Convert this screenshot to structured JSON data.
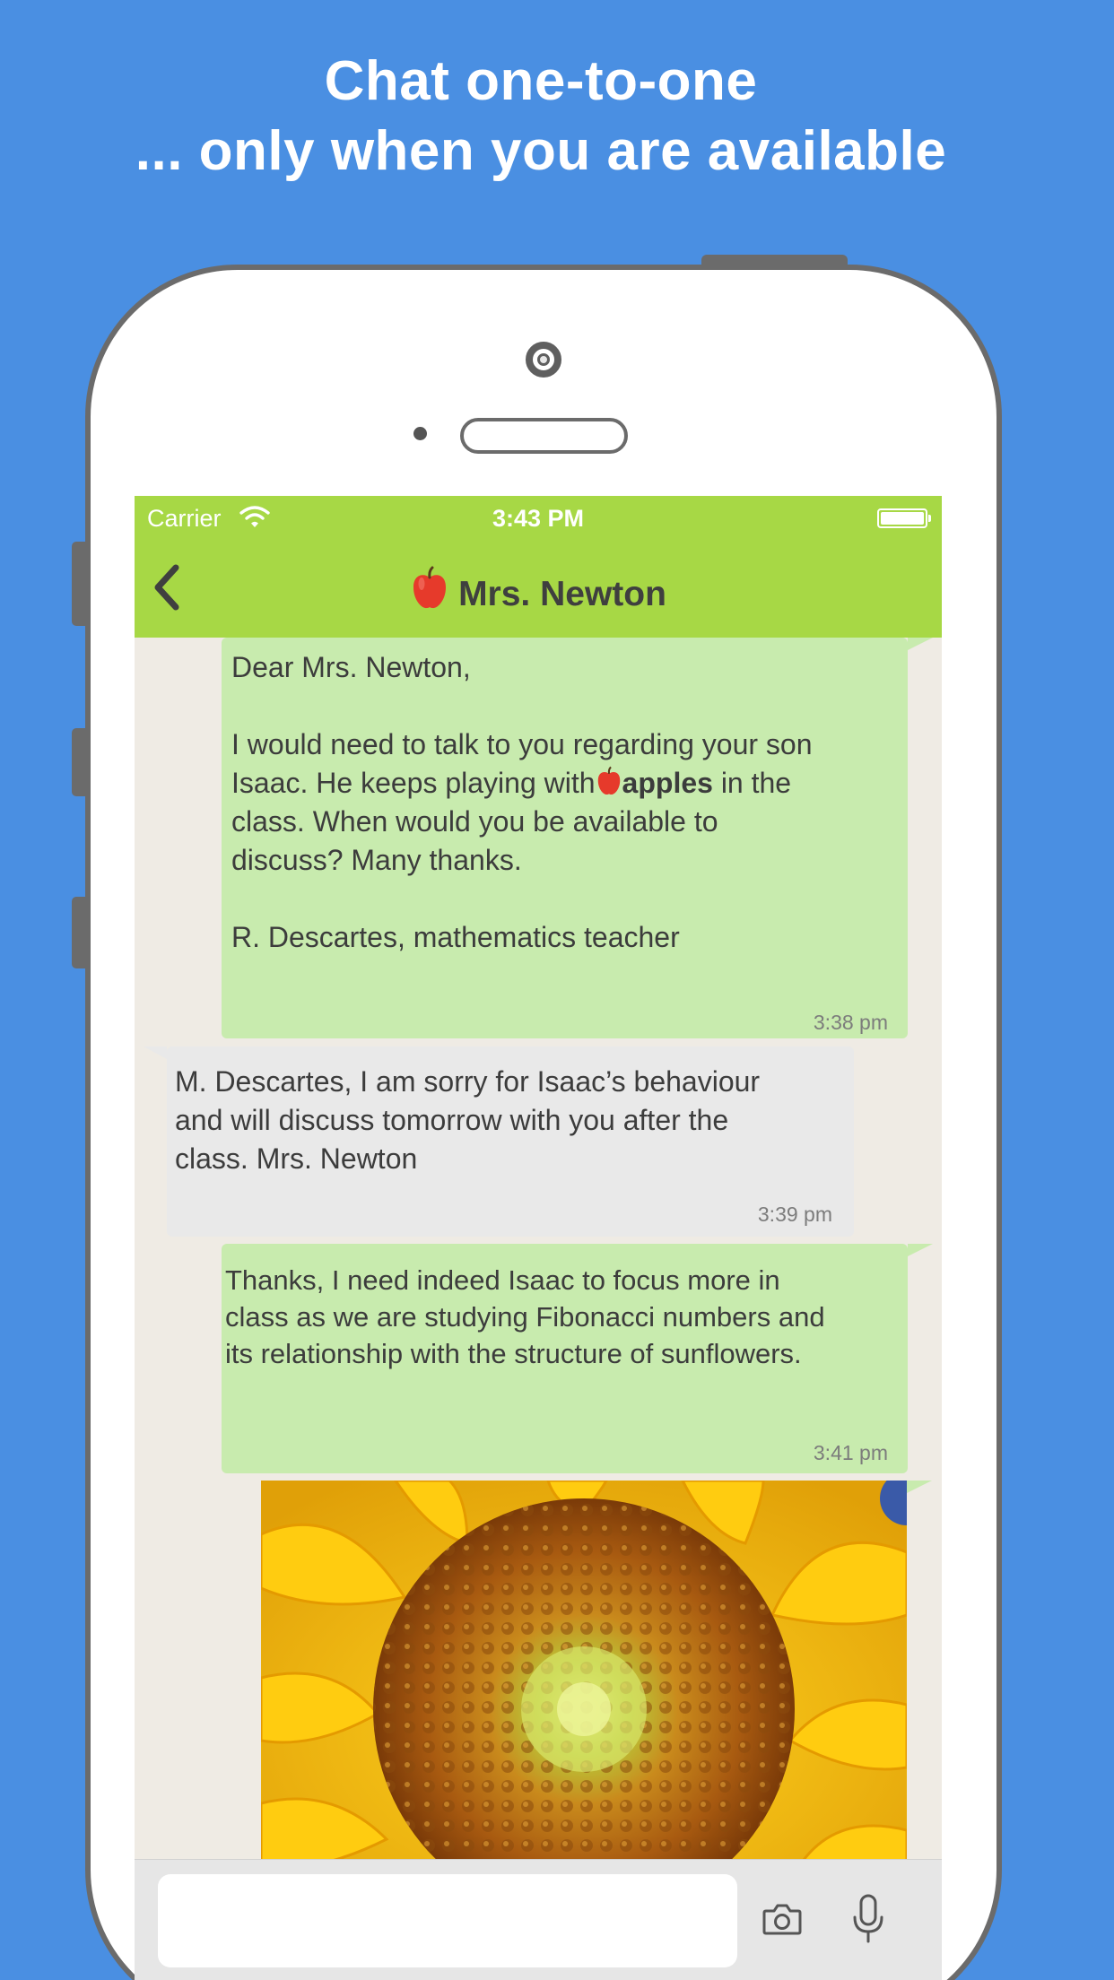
{
  "headline": {
    "line1": "Chat one-to-one",
    "line2": "... only when you are available"
  },
  "statusbar": {
    "carrier": "Carrier",
    "time": "3:43 PM"
  },
  "navbar": {
    "title": "Mrs. Newton",
    "title_icon": "apple-icon",
    "back_icon": "chevron-left-icon"
  },
  "messages": [
    {
      "direction": "outgoing",
      "greeting": "Dear Mrs. Newton,",
      "line1": "I would need to talk to you regarding your son",
      "line2_before": "Isaac. He keeps playing with",
      "line2_bold": "apples",
      "line2_after": " in the",
      "line3": "class. When would you be available to",
      "line4": "discuss? Many thanks.",
      "signature": "R. Descartes, mathematics teacher",
      "time": "3:38 pm"
    },
    {
      "direction": "incoming",
      "text": "M. Descartes, I am sorry for Isaac’s behaviour\nand will discuss tomorrow with you after the\nclass. Mrs. Newton",
      "time": "3:39 pm"
    },
    {
      "direction": "outgoing",
      "text": "Thanks, I need indeed Isaac to focus more in\nclass as we are studying Fibonacci numbers and\nits relationship with the structure of sunflowers.",
      "time": "3:41 pm"
    },
    {
      "direction": "outgoing",
      "type": "image",
      "image_subject": "sunflower"
    }
  ],
  "input": {
    "placeholder": "",
    "camera_icon": "camera-icon",
    "mic_icon": "microphone-icon"
  },
  "colors": {
    "background": "#4a8fe2",
    "navbar": "#a7d845",
    "outgoing_bubble": "#c8ebae",
    "incoming_bubble": "#e9e9e9",
    "chat_background": "#efebe4"
  }
}
